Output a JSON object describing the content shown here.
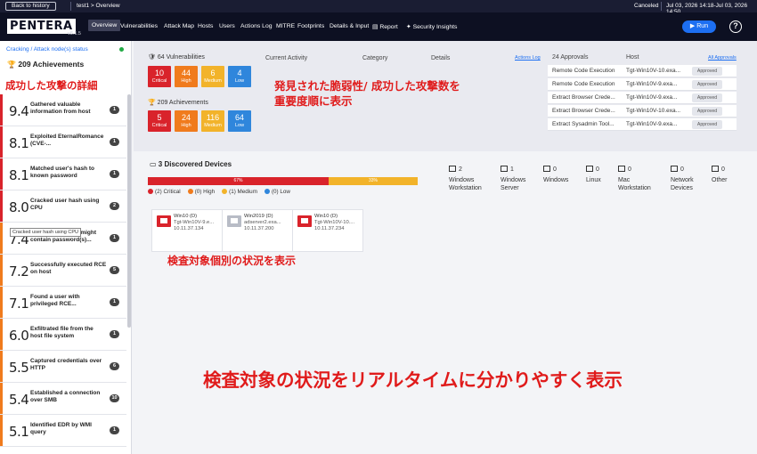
{
  "topbar": {
    "back_label": "Back to history",
    "breadcrumb": "test1 > Overview",
    "status": "Canceled",
    "dates": "Jul 03, 2026 14:18-Jul 03, 2026 14:50"
  },
  "header": {
    "logo": "PENTERA",
    "version": "v8.1.5",
    "nav": [
      "Overview",
      "Vulnerabilities",
      "Attack Map",
      "Hosts",
      "Users",
      "Actions Log",
      "MITRE",
      "Footprints",
      "Details & Input",
      "Report",
      "Security Insights"
    ],
    "run_label": "Run",
    "help_label": "?"
  },
  "sidebar": {
    "crumb": "Cracking / Attack node(s) status",
    "title": "209 Achievements",
    "annotation": "成功した攻撃の詳細",
    "tooltip": "Cracked user hash using CPU",
    "achievements": [
      {
        "score": "9.4",
        "text": "Gathered valuable information from host",
        "count": "1",
        "color": "#d9232b"
      },
      {
        "score": "8.1",
        "text": "Exploited EternalRomance (CVE-...",
        "count": "1",
        "color": "#d9232b"
      },
      {
        "score": "8.1",
        "text": "Matched user's hash to known password",
        "count": "1",
        "color": "#d9232b"
      },
      {
        "score": "8.0",
        "text": "Cracked user hash using CPU",
        "count": "2",
        "color": "#d9232b"
      },
      {
        "score": "7.4",
        "text": "Found a host that might contain password(s)...",
        "count": "1",
        "color": "#f07b1d"
      },
      {
        "score": "7.2",
        "text": "Successfully executed RCE on host",
        "count": "5",
        "color": "#f07b1d"
      },
      {
        "score": "7.1",
        "text": "Found a user with privileged RCE...",
        "count": "1",
        "color": "#f07b1d"
      },
      {
        "score": "6.0",
        "text": "Exfiltrated file from the host file system",
        "count": "1",
        "color": "#f07b1d"
      },
      {
        "score": "5.5",
        "text": "Captured credentials over HTTP",
        "count": "6",
        "color": "#f07b1d"
      },
      {
        "score": "5.4",
        "text": "Established a connection over SMB",
        "count": "10",
        "color": "#f07b1d"
      },
      {
        "score": "5.1",
        "text": "Identified EDR by WMI query",
        "count": "1",
        "color": "#f07b1d"
      }
    ]
  },
  "summary": {
    "vulnerabilities_title": "64 Vulnerabilities",
    "vulnerabilities": [
      {
        "value": "10",
        "label": "Critical",
        "color": "#d9232b"
      },
      {
        "value": "44",
        "label": "High",
        "color": "#f07b1d"
      },
      {
        "value": "6",
        "label": "Medium",
        "color": "#f2b32a"
      },
      {
        "value": "4",
        "label": "Low",
        "color": "#2f86dc"
      }
    ],
    "achievements_title": "209 Achievements",
    "achievements": [
      {
        "value": "5",
        "label": "Critical",
        "color": "#d9232b"
      },
      {
        "value": "24",
        "label": "High",
        "color": "#f07b1d"
      },
      {
        "value": "116",
        "label": "Medium",
        "color": "#f2b32a"
      },
      {
        "value": "64",
        "label": "Low",
        "color": "#2f86dc"
      }
    ],
    "activity_headers": [
      "Current Activity",
      "Category",
      "Details"
    ],
    "actions_log_link": "Actions Log",
    "annotation": "発見された脆弱性/ 成功した攻撃数を\n重要度順に表示"
  },
  "approvals": {
    "title": "24 Approvals",
    "host_header": "Host",
    "all_link": "All Approvals",
    "rows": [
      {
        "action": "Remote Code Execution",
        "host": "Tgt-Win10V-10.exa...",
        "status": "Approved"
      },
      {
        "action": "Remote Code Execution",
        "host": "Tgt-Win10V-9.exa...",
        "status": "Approved"
      },
      {
        "action": "Extract Browser Crede...",
        "host": "Tgt-Win10V-9.exa...",
        "status": "Approved"
      },
      {
        "action": "Extract Browser Crede...",
        "host": "Tgt-Win10V-10.exa...",
        "status": "Approved"
      },
      {
        "action": "Extract Sysadmin Tool...",
        "host": "Tgt-Win10V-9.exa...",
        "status": "Approved"
      }
    ]
  },
  "devices": {
    "title": "3 Discovered Devices",
    "bar": [
      {
        "label": "67%",
        "fraction": 0.67,
        "color": "#d9232b"
      },
      {
        "label": "33%",
        "fraction": 0.33,
        "color": "#f2b32a"
      }
    ],
    "legend": [
      {
        "label": "(2) Critical",
        "color": "#d9232b"
      },
      {
        "label": "(0) High",
        "color": "#f07b1d"
      },
      {
        "label": "(1) Medium",
        "color": "#f2b32a"
      },
      {
        "label": "(0) Low",
        "color": "#2f86dc"
      }
    ],
    "os": [
      {
        "count": "2",
        "label": "Windows Workstation"
      },
      {
        "count": "1",
        "label": "Windows Server"
      },
      {
        "count": "0",
        "label": "Windows"
      },
      {
        "count": "0",
        "label": "Linux"
      },
      {
        "count": "0",
        "label": "Mac Workstation"
      },
      {
        "count": "0",
        "label": "Network Devices"
      },
      {
        "count": "0",
        "label": "Other"
      }
    ],
    "hosts": [
      {
        "os": "Win10 (D)",
        "name": "Tgt-Win10V-9.e...",
        "ip": "10.11.37.134",
        "icon_color": "red"
      },
      {
        "os": "Win2019 (D)",
        "name": "adserver2.exa...",
        "ip": "10.11.37.200",
        "icon_color": "gray"
      },
      {
        "os": "Win10 (D)",
        "name": "Tgt-Win10V-10....",
        "ip": "10.11.37.234",
        "icon_color": "red"
      }
    ],
    "annotation": "検査対象個別の状況を表示"
  },
  "footer_annotation": "検査対象の状況をリアルタイムに分かりやすく表示"
}
